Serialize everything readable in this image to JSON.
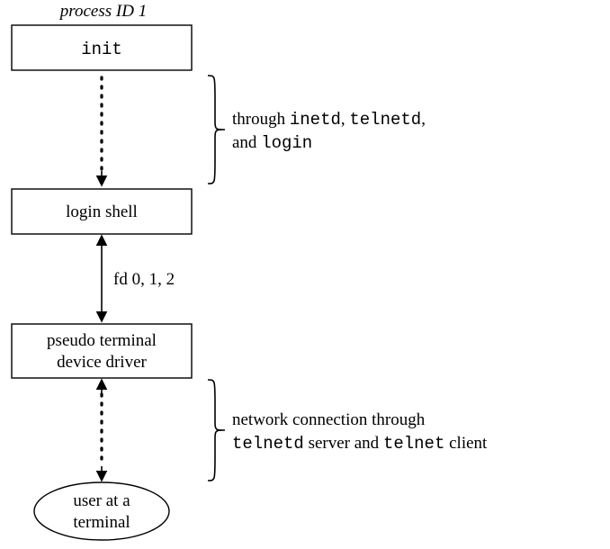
{
  "header": {
    "process_id_label": "process ID 1"
  },
  "nodes": {
    "init": "init",
    "login_shell": "login shell",
    "pseudo_line1": "pseudo terminal",
    "pseudo_line2": "device driver",
    "user_line1": "user at a",
    "user_line2": "terminal"
  },
  "labels": {
    "fd": "fd 0, 1, 2",
    "through_prefix": "through ",
    "through_inetd": "inetd",
    "through_comma": ", ",
    "through_telnetd": "telnetd",
    "through_comma2": ",",
    "through_and": "and ",
    "through_login": "login",
    "net_conn_prefix": "network connection through",
    "net_telnetd": "telnetd",
    "net_server_and": " server and ",
    "net_telnet": "telnet",
    "net_client": " client"
  }
}
